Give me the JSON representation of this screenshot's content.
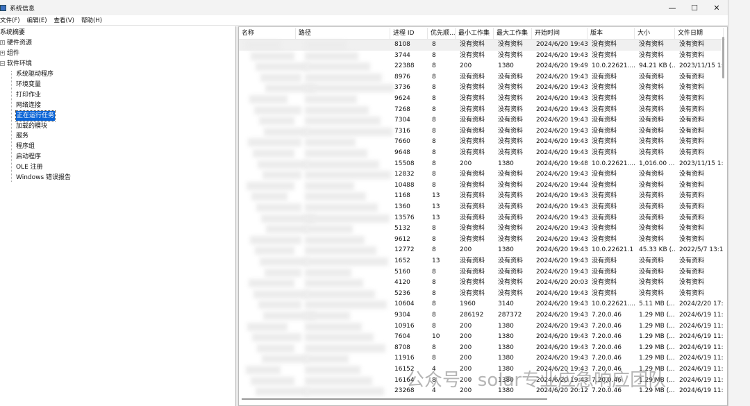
{
  "window": {
    "title": "系统信息",
    "controls": [
      "—",
      "☐",
      "✕"
    ]
  },
  "menu": [
    "文件(F)",
    "编辑(E)",
    "查看(V)",
    "帮助(H)"
  ],
  "tree": {
    "root": "系统摘要",
    "top": [
      {
        "label": "硬件资源",
        "sign": "+"
      },
      {
        "label": "组件",
        "sign": "+"
      },
      {
        "label": "软件环境",
        "sign": "−"
      }
    ],
    "children": [
      "系统驱动程序",
      "环境变量",
      "打印作业",
      "网络连接",
      "正在运行任务",
      "加载的模块",
      "服务",
      "程序组",
      "启动程序",
      "OLE 注册",
      "Windows 错误报告"
    ],
    "selected": "正在运行任务"
  },
  "columns": [
    "名称",
    "路径",
    "进程 ID",
    "优先顺...",
    "最小工作集",
    "最大工作集",
    "开始时间",
    "版本",
    "大小",
    "文件日期"
  ],
  "rows": [
    [
      "8108",
      "8",
      "没有资料",
      "没有资料",
      "2024/6/20 19:43",
      "没有资料",
      "没有资料",
      "没有资料"
    ],
    [
      "3744",
      "8",
      "没有资料",
      "没有资料",
      "2024/6/20 19:43",
      "没有资料",
      "没有资料",
      "没有资料"
    ],
    [
      "22388",
      "8",
      "200",
      "1380",
      "2024/6/20 19:49",
      "10.0.22621....",
      "94.21 KB (...",
      "2023/11/15 1:"
    ],
    [
      "8976",
      "8",
      "没有资料",
      "没有资料",
      "2024/6/20 19:43",
      "没有资料",
      "没有资料",
      "没有资料"
    ],
    [
      "3736",
      "8",
      "没有资料",
      "没有资料",
      "2024/6/20 19:43",
      "没有资料",
      "没有资料",
      "没有资料"
    ],
    [
      "9624",
      "8",
      "没有资料",
      "没有资料",
      "2024/6/20 19:43",
      "没有资料",
      "没有资料",
      "没有资料"
    ],
    [
      "7268",
      "8",
      "没有资料",
      "没有资料",
      "2024/6/20 19:43",
      "没有资料",
      "没有资料",
      "没有资料"
    ],
    [
      "7304",
      "8",
      "没有资料",
      "没有资料",
      "2024/6/20 19:43",
      "没有资料",
      "没有资料",
      "没有资料"
    ],
    [
      "7316",
      "8",
      "没有资料",
      "没有资料",
      "2024/6/20 19:43",
      "没有资料",
      "没有资料",
      "没有资料"
    ],
    [
      "7660",
      "8",
      "没有资料",
      "没有资料",
      "2024/6/20 19:43",
      "没有资料",
      "没有资料",
      "没有资料"
    ],
    [
      "9648",
      "8",
      "没有资料",
      "没有资料",
      "2024/6/20 19:43",
      "没有资料",
      "没有资料",
      "没有资料"
    ],
    [
      "15508",
      "8",
      "200",
      "1380",
      "2024/6/20 19:48",
      "10.0.22621....",
      "1,016.00 ...",
      "2023/11/15 1:"
    ],
    [
      "12832",
      "8",
      "没有资料",
      "没有资料",
      "2024/6/20 19:43",
      "没有资料",
      "没有资料",
      "没有资料"
    ],
    [
      "10488",
      "8",
      "没有资料",
      "没有资料",
      "2024/6/20 19:44",
      "没有资料",
      "没有资料",
      "没有资料"
    ],
    [
      "1168",
      "13",
      "没有资料",
      "没有资料",
      "2024/6/20 19:43",
      "没有资料",
      "没有资料",
      "没有资料"
    ],
    [
      "1360",
      "13",
      "没有资料",
      "没有资料",
      "2024/6/20 19:43",
      "没有资料",
      "没有资料",
      "没有资料"
    ],
    [
      "13576",
      "13",
      "没有资料",
      "没有资料",
      "2024/6/20 19:43",
      "没有资料",
      "没有资料",
      "没有资料"
    ],
    [
      "5132",
      "8",
      "没有资料",
      "没有资料",
      "2024/6/20 19:43",
      "没有资料",
      "没有资料",
      "没有资料"
    ],
    [
      "9612",
      "8",
      "没有资料",
      "没有资料",
      "2024/6/20 19:43",
      "没有资料",
      "没有资料",
      "没有资料"
    ],
    [
      "12772",
      "8",
      "200",
      "1380",
      "2024/6/20 19:43",
      "10.0.22621.1",
      "45.33 KB (...",
      "2022/5/7 13:1"
    ],
    [
      "1652",
      "13",
      "没有资料",
      "没有资料",
      "2024/6/20 19:43",
      "没有资料",
      "没有资料",
      "没有资料"
    ],
    [
      "5160",
      "8",
      "没有资料",
      "没有资料",
      "2024/6/20 19:43",
      "没有资料",
      "没有资料",
      "没有资料"
    ],
    [
      "4120",
      "8",
      "没有资料",
      "没有资料",
      "2024/6/20 20:03",
      "没有资料",
      "没有资料",
      "没有资料"
    ],
    [
      "5236",
      "8",
      "没有资料",
      "没有资料",
      "2024/6/20 19:43",
      "没有资料",
      "没有资料",
      "没有资料"
    ],
    [
      "10604",
      "8",
      "1960",
      "3140",
      "2024/6/20 19:43",
      "10.0.22621....",
      "5.11 MB (...",
      "2024/2/20 17:"
    ],
    [
      "9304",
      "8",
      "286192",
      "287372",
      "2024/6/20 19:43",
      "7.20.0.46",
      "1.29 MB (...",
      "2024/6/19 11:"
    ],
    [
      "10916",
      "8",
      "200",
      "1380",
      "2024/6/20 19:43",
      "7.20.0.46",
      "1.29 MB (...",
      "2024/6/19 11:"
    ],
    [
      "7604",
      "10",
      "200",
      "1380",
      "2024/6/20 19:43",
      "7.20.0.46",
      "1.29 MB (...",
      "2024/6/19 11:"
    ],
    [
      "8708",
      "8",
      "200",
      "1380",
      "2024/6/20 19:43",
      "7.20.0.46",
      "1.29 MB (...",
      "2024/6/19 11:"
    ],
    [
      "11916",
      "8",
      "200",
      "1380",
      "2024/6/20 19:43",
      "7.20.0.46",
      "1.29 MB (...",
      "2024/6/19 11:"
    ],
    [
      "16152",
      "4",
      "200",
      "1380",
      "2024/6/20 19:43",
      "7.20.0.46",
      "1.29 MB (...",
      "2024/6/19 11:"
    ],
    [
      "16164",
      "8",
      "200",
      "1380",
      "2024/6/20 19:43",
      "7.20.0.46",
      "1.29 MB (...",
      "2024/6/19 11:"
    ],
    [
      "23268",
      "4",
      "200",
      "1380",
      "2024/6/20 20:12",
      "7.20.0.46",
      "1.29 MB (...",
      "2024/6/19 11:"
    ]
  ],
  "watermark": "公众号 · solar专业应急响应团队"
}
